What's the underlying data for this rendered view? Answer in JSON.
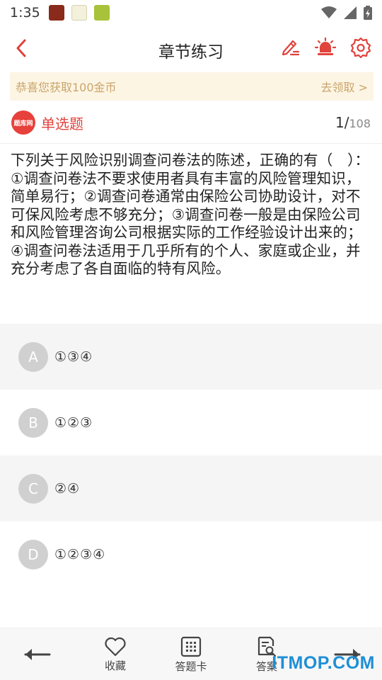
{
  "status_bar": {
    "time": "1:35",
    "app_icons": [
      "app-icon-1",
      "app-icon-2",
      "app-icon-3"
    ]
  },
  "header": {
    "title": "章节练习",
    "icons": [
      "back-icon",
      "edit-icon",
      "night-mode-icon",
      "settings-icon"
    ],
    "accent_color": "#e0433c"
  },
  "banner": {
    "text": "恭喜您获取100金币",
    "link": "去领取 >"
  },
  "question_meta": {
    "logo_text": "题库网",
    "type": "单选题",
    "current": "1",
    "separator": "/",
    "total": "108"
  },
  "question": {
    "text": "下列关于风险识别调查问卷法的陈述，正确的有（　）：①调查问卷法不要求使用者具有丰富的风险管理知识，简单易行；②调查问卷通常由保险公司协助设计，对不可保风险考虑不够充分；③调查问卷一般是由保险公司和风险管理咨询公司根据实际的工作经验设计出来的；④调查问卷法适用于几乎所有的个人、家庭或企业，并充分考虑了各自面临的特有风险。"
  },
  "options": [
    {
      "letter": "A",
      "text": "①③④"
    },
    {
      "letter": "B",
      "text": "①②③"
    },
    {
      "letter": "C",
      "text": "②④"
    },
    {
      "letter": "D",
      "text": "①②③④"
    }
  ],
  "bottom_nav": {
    "favorite": "收藏",
    "answer_card": "答题卡",
    "answer": "答案"
  },
  "watermark": "ITMOP.COM"
}
